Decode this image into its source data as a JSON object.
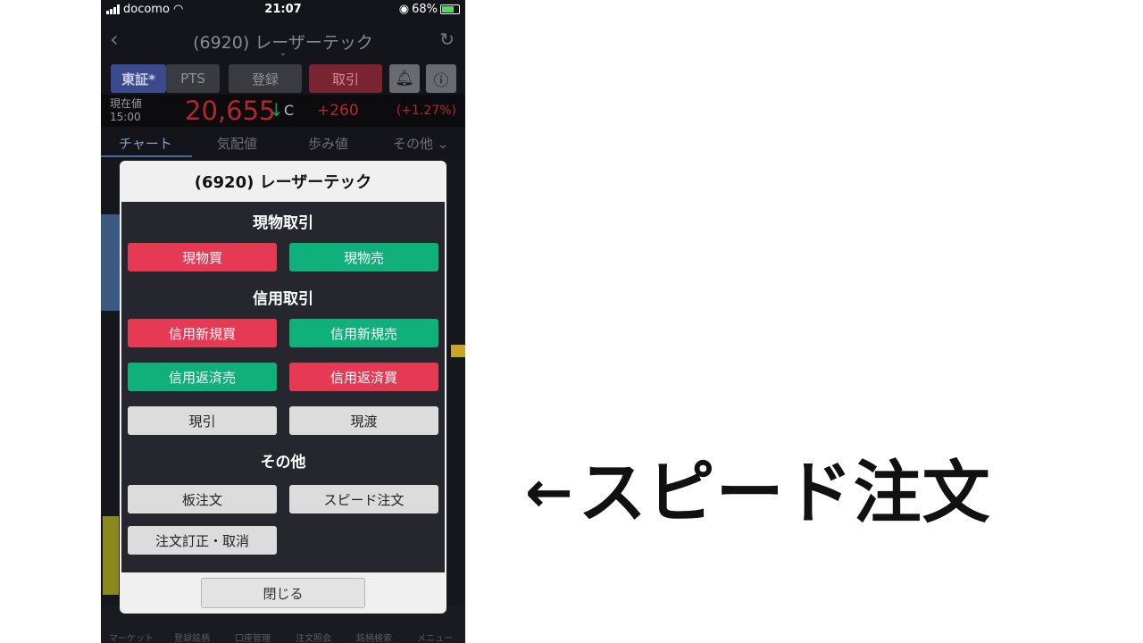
{
  "status_bar": {
    "carrier": "docomo",
    "time": "21:07",
    "battery": "68%"
  },
  "nav": {
    "title": "(6920) レーザーテック"
  },
  "market_buttons": {
    "tosho": "東証*",
    "pts": "PTS",
    "register": "登録",
    "trade": "取引"
  },
  "price": {
    "label_current": "現在値",
    "label_time": "15:00",
    "value": "20,655",
    "close_mark": "C",
    "change": "+260",
    "change_pct": "(+1.27%)"
  },
  "tabs": [
    "チャート",
    "気配値",
    "歩み値",
    "その他"
  ],
  "modal": {
    "title": "(6920) レーザーテック",
    "sections": {
      "spot": "現物取引",
      "margin": "信用取引",
      "other": "その他"
    },
    "buttons": {
      "spot_buy": "現物買",
      "spot_sell": "現物売",
      "margin_new_buy": "信用新規買",
      "margin_new_sell": "信用新規売",
      "margin_repay_sell": "信用返済売",
      "margin_repay_buy": "信用返済買",
      "genbiki": "現引",
      "genwatashi": "現渡",
      "board_order": "板注文",
      "speed_order": "スピード注文",
      "modify_cancel": "注文訂正・取消"
    },
    "close": "閉じる"
  },
  "bottom_nav": [
    "マーケット",
    "登録銘柄",
    "口座管理",
    "注文照会",
    "銘柄検索",
    "メニュー"
  ],
  "annotation": {
    "arrow": "←",
    "text": "スピード注文"
  },
  "colors": {
    "buy_red": "#e63a54",
    "sell_green": "#0fb07a",
    "price_red": "#b3262f"
  }
}
